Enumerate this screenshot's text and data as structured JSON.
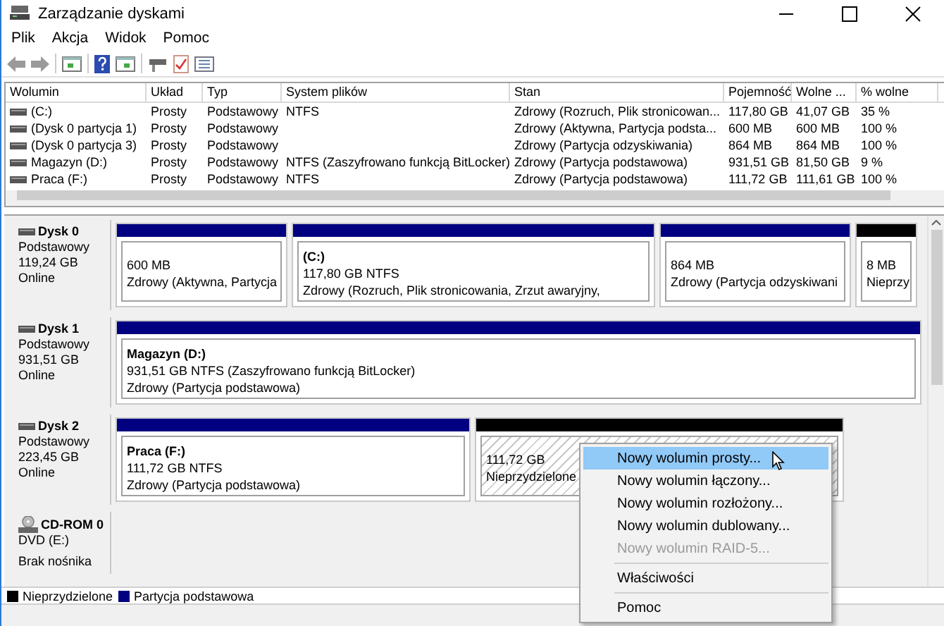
{
  "window": {
    "title": "Zarządzanie dyskami"
  },
  "menu": [
    "Plik",
    "Akcja",
    "Widok",
    "Pomoc"
  ],
  "volume_table": {
    "columns": [
      "Wolumin",
      "Układ",
      "Typ",
      "System plików",
      "Stan",
      "Pojemność",
      "Wolne ...",
      "% wolne"
    ],
    "rows": [
      {
        "cells": [
          "(C:)",
          "Prosty",
          "Podstawowy",
          "NTFS",
          "Zdrowy (Rozruch, Plik stronicowan...",
          "117,80 GB",
          "41,07 GB",
          "35 %"
        ]
      },
      {
        "cells": [
          "(Dysk 0 partycja 1)",
          "Prosty",
          "Podstawowy",
          null,
          "Zdrowy (Aktywna, Partycja podsta...",
          "600 MB",
          "600 MB",
          "100 %"
        ]
      },
      {
        "cells": [
          "(Dysk 0 partycja 3)",
          "Prosty",
          "Podstawowy",
          null,
          "Zdrowy (Partycja odzyskiwania)",
          "864 MB",
          "864 MB",
          "100 %"
        ]
      },
      {
        "cells": [
          "Magazyn (D:)",
          "Prosty",
          "Podstawowy",
          "NTFS (Zaszyfrowano funkcją BitLocker)",
          "Zdrowy (Partycja podstawowa)",
          "931,51 GB",
          "81,50 GB",
          "9 %"
        ]
      },
      {
        "cells": [
          "Praca (F:)",
          "Prosty",
          "Podstawowy",
          "NTFS",
          "Zdrowy (Partycja podstawowa)",
          "111,72 GB",
          "111,61 GB",
          "100 %"
        ]
      }
    ]
  },
  "disks": [
    {
      "kind": "disk",
      "name": "Dysk 0",
      "type": "Podstawowy",
      "size": "119,24 GB",
      "status": "Online",
      "partitions": [
        {
          "kind": "primary",
          "size": "600 MB",
          "status": "Zdrowy (Aktywna, Partycja",
          "selected": false
        },
        {
          "kind": "primary",
          "name": "(C:)",
          "size": "117,80 GB NTFS",
          "status": "Zdrowy (Rozruch, Plik stronicowania, Zrzut awaryjny,",
          "selected": false
        },
        {
          "kind": "primary",
          "size": "864 MB",
          "status": "Zdrowy (Partycja odzyskiwani",
          "selected": false
        },
        {
          "kind": "unallocated",
          "size": "8 MB",
          "status": "Nieprzy",
          "selected": false
        }
      ]
    },
    {
      "kind": "disk",
      "name": "Dysk 1",
      "type": "Podstawowy",
      "size": "931,51 GB",
      "status": "Online",
      "partitions": [
        {
          "kind": "primary",
          "name": "Magazyn  (D:)",
          "size": "931,51 GB NTFS (Zaszyfrowano funkcją BitLocker)",
          "status": "Zdrowy (Partycja podstawowa)",
          "selected": false
        }
      ]
    },
    {
      "kind": "disk",
      "name": "Dysk 2",
      "type": "Podstawowy",
      "size": "223,45 GB",
      "status": "Online",
      "partitions": [
        {
          "kind": "primary",
          "name": "Praca  (F:)",
          "size": "111,72 GB NTFS",
          "status": "Zdrowy (Partycja podstawowa)",
          "selected": false
        },
        {
          "kind": "unallocated",
          "size": "111,72 GB",
          "status": "Nieprzydzielone",
          "selected": true
        }
      ]
    },
    {
      "kind": "cdrom",
      "name": "CD-ROM 0",
      "type": "DVD (E:)",
      "status": "Brak nośnika"
    }
  ],
  "legend": [
    {
      "label": "Nieprzydzielone",
      "color": "#000000"
    },
    {
      "label": "Partycja podstawowa",
      "color": "#000080"
    }
  ],
  "context_menu": {
    "items": [
      {
        "kind": "item",
        "label": "Nowy wolumin prosty...",
        "selected": true,
        "disabled": false
      },
      {
        "kind": "item",
        "label": "Nowy wolumin łączony...",
        "selected": false,
        "disabled": false
      },
      {
        "kind": "item",
        "label": "Nowy wolumin rozłożony...",
        "selected": false,
        "disabled": false
      },
      {
        "kind": "item",
        "label": "Nowy wolumin dublowany...",
        "selected": false,
        "disabled": false
      },
      {
        "kind": "item",
        "label": "Nowy wolumin RAID-5...",
        "selected": false,
        "disabled": true
      },
      {
        "kind": "separator"
      },
      {
        "kind": "item",
        "label": "Właściwości",
        "selected": false,
        "disabled": false
      },
      {
        "kind": "separator"
      },
      {
        "kind": "item",
        "label": "Pomoc",
        "selected": false,
        "disabled": false
      }
    ]
  }
}
